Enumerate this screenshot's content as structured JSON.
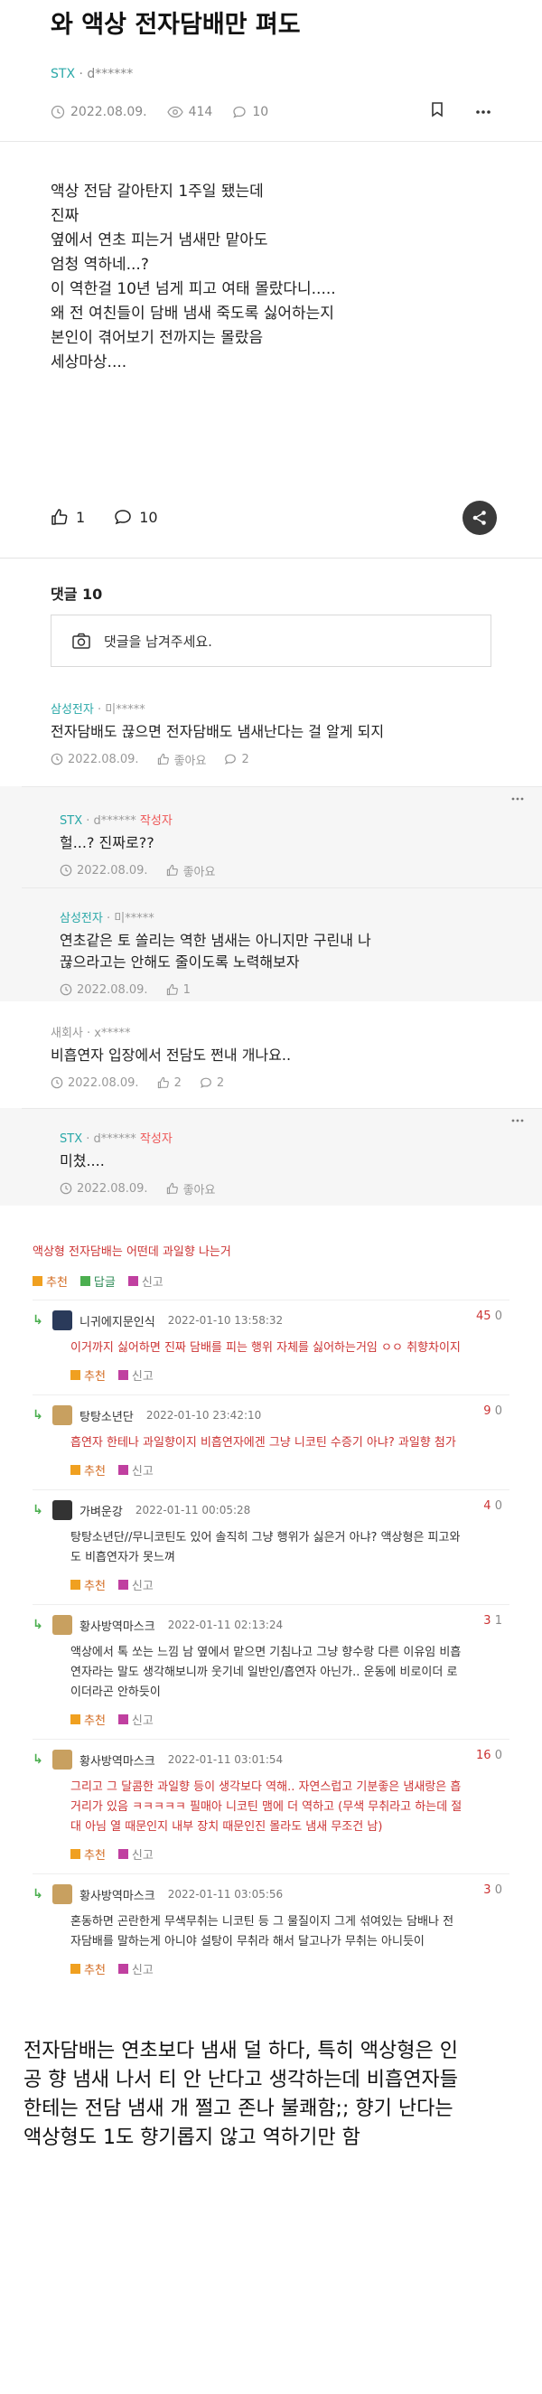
{
  "post": {
    "title": "와 액상 전자담배만 펴도",
    "board": "STX",
    "author": "· d******",
    "date": "2022.08.09.",
    "views": "414",
    "comments": "10",
    "body": [
      "액상 전담 갈아탄지 1주일 됐는데",
      "진짜",
      "옆에서 연초 피는거 냄새만 맡아도",
      "엄청 역하네...?",
      "이 역한걸 10년 넘게 피고 여태 몰랐다니.....",
      "왜 전 여친들이 담배 냄새 죽도록 싫어하는지",
      "본인이 겪어보기 전까지는 몰랐음",
      "세상마상...."
    ],
    "likes": "1",
    "comment_count": "10"
  },
  "comments_section": {
    "heading": "댓글 10",
    "input_placeholder": "댓글을 남겨주세요."
  },
  "comments": [
    {
      "board": "삼성전자",
      "author": "· 미*****",
      "op": "",
      "text": [
        "전자담배도 끊으면 전자담배도 냄새난다는 걸 알게 되지"
      ],
      "date": "2022.08.09.",
      "likes": "좋아요",
      "replies": "2"
    },
    {
      "board": "STX",
      "author": "· d******",
      "op": "작성자",
      "text": [
        "헐...? 진짜로??"
      ],
      "date": "2022.08.09.",
      "likes": "좋아요"
    },
    {
      "board": "삼성전자",
      "author": "· 미*****",
      "op": "",
      "text": [
        "연초같은 토 쏠리는 역한 냄새는 아니지만 구린내 나",
        "끊으라고는 안해도 줄이도록 노력해보자"
      ],
      "date": "2022.08.09.",
      "likes": "1"
    },
    {
      "board": "새회사",
      "author": "· x*****",
      "op": "",
      "text": [
        "비흡연자 입장에서 전담도 쩐내 개나요.."
      ],
      "date": "2022.08.09.",
      "likes": "2",
      "replies": "2"
    },
    {
      "board": "STX",
      "author": "· d******",
      "op": "작성자",
      "text": [
        "미쳤...."
      ],
      "date": "2022.08.09.",
      "likes": "좋아요"
    }
  ],
  "old_thread": {
    "title": "액상형 전자담배는 어떤데 과일향 나는거",
    "recommend": "추천",
    "answer": "답글",
    "report": "신고",
    "comments": [
      {
        "nick": "니귀에지문인식",
        "date": "2022-01-10 13:58:32",
        "score": "45",
        "zero": "0",
        "style": "red",
        "avatar": "#2a3a5a",
        "text": [
          "이거까지 싫어하면 진짜 담배를 피는 행위 자체를 싫어하는거임 ㅇㅇ 취향차이지"
        ]
      },
      {
        "nick": "탕탕소년단",
        "date": "2022-01-10 23:42:10",
        "score": "9",
        "zero": "0",
        "style": "red",
        "avatar": "#c8a060",
        "text": [
          "흡연자 한테나 과일향이지 비흡연자에겐 그냥 니코틴 수증기 아냐? 과일향 첨가"
        ]
      },
      {
        "nick": "가벼운강",
        "date": "2022-01-11 00:05:28",
        "score": "4",
        "zero": "0",
        "style": "dark",
        "avatar": "#333333",
        "text": [
          "탕탕소년단//무니코틴도 있어 솔직히 그냥 행위가 싫은거 아냐? 액상형은 피고와",
          "도 비흡연자가 못느껴"
        ]
      },
      {
        "nick": "황사방역마스크",
        "date": "2022-01-11 02:13:24",
        "score": "3",
        "zero": "1",
        "style": "dark",
        "avatar": "#c8a060",
        "text": [
          "액상에서 톡 쏘는 느낌 남 옆에서 맡으면 기침나고 그냥 향수랑 다른 이유임 비흡",
          "연자라는 말도 생각해보니까 웃기네 일반인/흡연자 아닌가.. 운동에 비로이더 로",
          "이더라곤 안하듯이"
        ]
      },
      {
        "nick": "황사방역마스크",
        "date": "2022-01-11 03:01:54",
        "score": "16",
        "zero": "0",
        "style": "red",
        "avatar": "#c8a060",
        "text": [
          "그리고 그 달콤한 과일향 등이 생각보다 역해.. 자연스럽고 기분좋은 냄새랑은 흡",
          "거리가 있음 ㅋㅋㅋㅋㅋ 필매아 니코틴 맴에 더 역하고 (무색 무취라고 하는데 절",
          "대 아님 열 때문인지 내부 장치 때문인진 몰라도 냄새 무조건 남)"
        ]
      },
      {
        "nick": "황사방역마스크",
        "date": "2022-01-11 03:05:56",
        "score": "3",
        "zero": "0",
        "style": "dark",
        "avatar": "#c8a060",
        "text": [
          "혼동하면 곤란한게 무색무취는 니코틴 등 그 물질이지 그게 섞여있는 담배나 전",
          "자담배를 말하는게 아니야 설탕이 무취라 해서 달고나가 무취는 아니듯이"
        ]
      }
    ]
  },
  "summary": [
    "전자담배는 연초보다 냄새 덜 하다, 특히 액상형은 인",
    "공 향 냄새 나서 티 안 난다고 생각하는데 비흡연자들",
    "한테는 전담 냄새 개 쩔고 존나 불쾌함;; 향기 난다는",
    "액상형도 1도 향기롭지 않고 역하기만 함"
  ]
}
